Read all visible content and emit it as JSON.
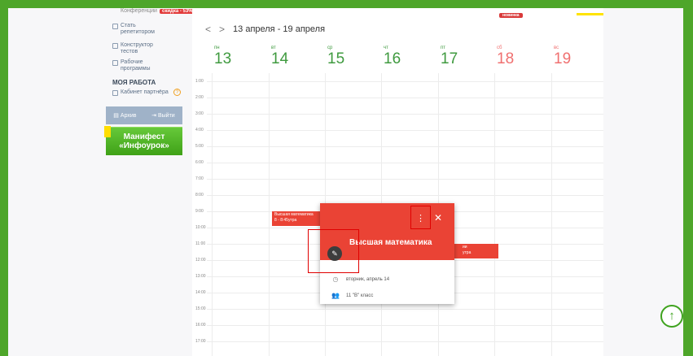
{
  "sidebar": {
    "top_cut_text": "Конференции",
    "top_badge": "скидка - 53%",
    "items": [
      {
        "label": "Стать репетитором"
      },
      {
        "label": "Конструктор тестов"
      },
      {
        "label": "Рабочие программы"
      }
    ],
    "section_title": "МОЯ РАБОТА",
    "partner_label": "Кабинет партнёра",
    "help_label": "?",
    "archive_label": "Архив",
    "exit_label": "Выйти",
    "manifest_line1": "Манифест",
    "manifest_line2": "«Инфоурок»"
  },
  "calendar": {
    "prev": "<",
    "next": ">",
    "range": "13 апреля - 19 апреля",
    "new_badge": "новинка",
    "days": [
      {
        "name": "пн",
        "num": "13"
      },
      {
        "name": "вт",
        "num": "14"
      },
      {
        "name": "ср",
        "num": "15"
      },
      {
        "name": "чт",
        "num": "16"
      },
      {
        "name": "пт",
        "num": "17"
      },
      {
        "name": "сб",
        "num": "18"
      },
      {
        "name": "вс",
        "num": "19"
      }
    ],
    "hours": [
      "1:00",
      "2:00",
      "3:00",
      "4:00",
      "5:00",
      "6:00",
      "7:00",
      "8:00",
      "9:00",
      "10:00",
      "11:00",
      "12:00",
      "13:00",
      "14:00",
      "15:00",
      "16:00",
      "17:00"
    ],
    "event_tue": {
      "title": "Высшая математика",
      "time": "8 - 8:45утра"
    },
    "event_thu": {
      "title": "ии",
      "time": "утра"
    }
  },
  "popup": {
    "title": "Высшая математика",
    "date": "вторник, апрель 14",
    "group": "11 \"В\" класс",
    "menu_glyph": "⋮",
    "close_glyph": "✕",
    "edit_glyph": "✎"
  },
  "scroll_up_glyph": "↑",
  "colors": {
    "accent": "#4ea62a",
    "event": "#ea4335"
  }
}
